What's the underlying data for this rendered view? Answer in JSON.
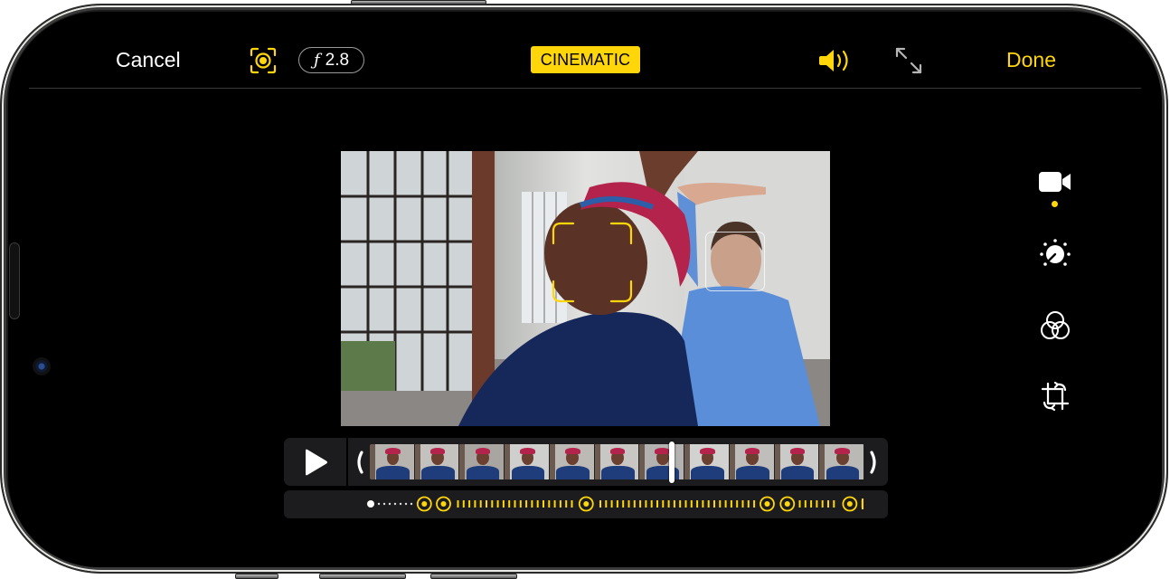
{
  "toolbar": {
    "cancel_label": "Cancel",
    "done_label": "Done",
    "aperture_symbol": "ƒ",
    "aperture_value": "2.8",
    "mode_badge": "CINEMATIC",
    "focus_icon": "focus-lock-icon",
    "audio_icon": "speaker-wave-icon",
    "expand_icon": "expand-arrows-icon"
  },
  "colors": {
    "accent": "#ffd60a",
    "background": "#000000",
    "panel": "#1c1c1e",
    "text": "#ffffff"
  },
  "video": {
    "primary_subject_focus": "face-focus-primary",
    "secondary_subject_detected": "face-focus-secondary"
  },
  "edit_tools": [
    {
      "name": "video",
      "icon": "video-camera-icon",
      "active": true
    },
    {
      "name": "adjust",
      "icon": "adjust-dial-icon",
      "active": false
    },
    {
      "name": "filters",
      "icon": "filters-circles-icon",
      "active": false
    },
    {
      "name": "crop",
      "icon": "crop-rotate-icon",
      "active": false
    }
  ],
  "timeline": {
    "play_icon": "play-icon",
    "thumbnail_count": 11,
    "playhead_position": 0.61,
    "focus_points": [
      0.109,
      0.148,
      0.438,
      0.806,
      0.847,
      0.974,
      1.0
    ],
    "focus_track_start": 0.0,
    "focus_track_end": 1.0
  }
}
